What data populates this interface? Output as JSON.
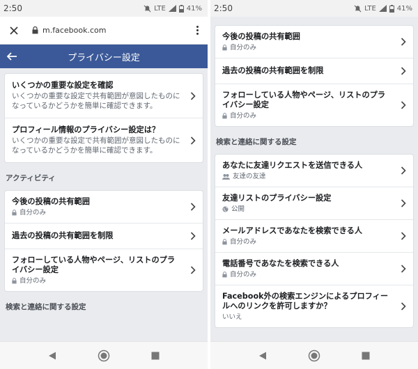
{
  "left": {
    "status": {
      "time": "2:50",
      "network": "LTE",
      "battery": "41%"
    },
    "browser": {
      "url": "m.facebook.com"
    },
    "header": {
      "title": "プライバシー設定"
    },
    "top_items": [
      {
        "title": "いくつかの重要な設定を確認",
        "desc": "いくつかの重要な設定で共有範囲が意図したものになっているかどうかを簡単に確認できます。"
      },
      {
        "title": "プロフィール情報のプライバシー設定は？",
        "desc": "いくつかの重要な設定で共有範囲が意図したものになっているかどうかを簡単に確認できます。"
      }
    ],
    "section_activity": "アクティビティ",
    "activity_items": [
      {
        "title": "今後の投稿の共有範囲",
        "value": "自分のみ"
      },
      {
        "title": "過去の投稿の共有範囲を制限"
      },
      {
        "title": "フォローしている人物やページ、リストのプライバシー設定",
        "value": "自分のみ"
      }
    ],
    "section_search_cut": "検索と連絡に関する設定"
  },
  "right": {
    "status": {
      "time": "2:50",
      "network": "LTE",
      "battery": "41%"
    },
    "activity_items": [
      {
        "title": "今後の投稿の共有範囲",
        "value": "自分のみ"
      },
      {
        "title": "過去の投稿の共有範囲を制限"
      },
      {
        "title": "フォローしている人物やページ、リストのプライバシー設定",
        "value": "自分のみ"
      }
    ],
    "section_search": "検索と連絡に関する設定",
    "search_items": [
      {
        "title": "あなたに友達リクエストを送信できる人",
        "value": "友達の友達",
        "icon": "friends-icon"
      },
      {
        "title": "友達リストのプライバシー設定",
        "value": "公開",
        "icon": "globe-icon"
      },
      {
        "title": "メールアドレスであなたを検索できる人",
        "value": "自分のみ",
        "icon": "lock-icon"
      },
      {
        "title": "電話番号であなたを検索できる人",
        "value": "自分のみ",
        "icon": "lock-icon"
      },
      {
        "title": "Facebook外の検索エンジンによるプロフィールへのリンクを許可しますか？",
        "value": "いいえ"
      }
    ]
  },
  "colors": {
    "fb_blue": "#3b5998",
    "background": "#e9ebee",
    "text": "#1c1e21",
    "muted": "#606770"
  }
}
